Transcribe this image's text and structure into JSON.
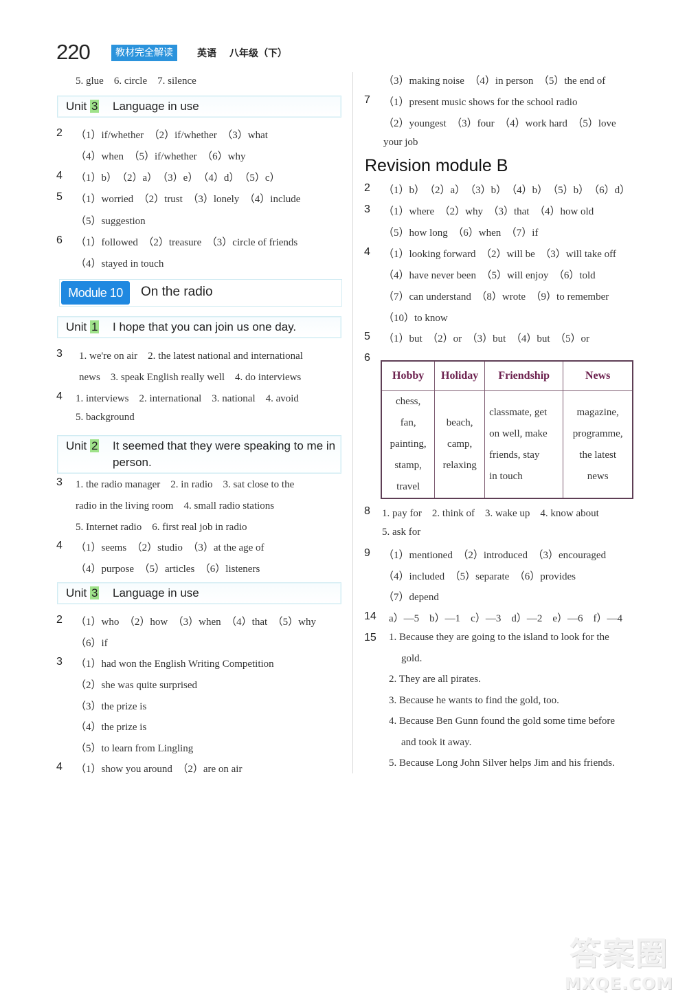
{
  "header": {
    "page_number": "220",
    "book_badge": "教材完全解读",
    "subject": "英语",
    "grade": "八年级（下）"
  },
  "left": {
    "line0": "5. glue　6. circle　7. silence",
    "unit3a": {
      "word": "Unit",
      "num": "3",
      "title": "Language in use"
    },
    "q2": {
      "num": "2",
      "lines": [
        "（1）if/whether　（2）if/whether　（3）what",
        "（4）when　（5）if/whether　（6）why"
      ]
    },
    "q4": {
      "num": "4",
      "lines": [
        "（1）b）　（2）a）　（3）e）　（4）d）　（5）c）"
      ]
    },
    "q5": {
      "num": "5",
      "lines": [
        "（1）worried　（2）trust　（3）lonely　（4）include",
        "（5）suggestion"
      ]
    },
    "q6": {
      "num": "6",
      "lines": [
        "（1）followed　（2）treasure　（3）circle of friends",
        "（4）stayed in touch"
      ]
    },
    "module10": {
      "tag": "Module 10",
      "title": "On the radio"
    },
    "unit1": {
      "word": "Unit",
      "num": "1",
      "title": "I hope that you can join us one day."
    },
    "u1q3": {
      "num": "3",
      "lines": [
        "1. we're on air　2. the latest national and international",
        "news　3. speak English really well　4. do interviews"
      ]
    },
    "u1q4": {
      "num": "4",
      "lines": [
        "1. interviews　2. international　3. national　4. avoid",
        "5. background"
      ]
    },
    "unit2": {
      "word": "Unit",
      "num": "2",
      "title_line1": "It seemed that they were speaking to me in",
      "title_line2": "person."
    },
    "u2q3": {
      "num": "3",
      "lines": [
        "1. the radio manager　2. in radio　3. sat close to the",
        "radio in the living room　4. small radio stations",
        "5. Internet radio　6. first real job in radio"
      ]
    },
    "u2q4": {
      "num": "4",
      "lines": [
        "（1）seems　（2）studio　（3）at the age of",
        "（4）purpose　（5）articles　（6）listeners"
      ]
    },
    "unit3b": {
      "word": "Unit",
      "num": "3",
      "title": "Language in use"
    },
    "u3q2": {
      "num": "2",
      "lines": [
        "（1）who　（2）how　（3）when　（4）that　（5）why",
        "（6）if"
      ]
    },
    "u3q3": {
      "num": "3",
      "lines": [
        "（1）had won the English Writing Competition",
        "（2）she was quite surprised",
        "（3）the prize is",
        "（4）the prize is",
        "（5）to learn from Lingling"
      ]
    },
    "u3q4": {
      "num": "4",
      "lines": [
        "（1）show you around　（2）are on air"
      ]
    }
  },
  "right": {
    "cont": {
      "lines": [
        "（3）making noise　（4）in person　（5）the end of"
      ]
    },
    "q7": {
      "num": "7",
      "lines": [
        "（1）present music shows for the school radio",
        "（2）youngest　（3）four　（4）work hard　（5）love",
        "your job"
      ]
    },
    "revision_title": "Revision module B",
    "rq2": {
      "num": "2",
      "lines": [
        "（1）b）　（2）a）　（3）b）　（4）b）　（5）b）　（6）d）"
      ]
    },
    "rq3": {
      "num": "3",
      "lines": [
        "（1）where　（2）why　（3）that　（4）how old",
        "（5）how long　（6）when　（7）if"
      ]
    },
    "rq4": {
      "num": "4",
      "lines": [
        "（1）looking forward　（2）will be　（3）will take off",
        "（4）have never been　（5）will enjoy　（6）told",
        "（7）can understand　（8）wrote　（9）to remember",
        "（10）to know"
      ]
    },
    "rq5": {
      "num": "5",
      "lines": [
        "（1）but　（2）or　（3）but　（4）but　（5）or"
      ]
    },
    "rq6": {
      "num": "6",
      "headers": [
        "Hobby",
        "Holiday",
        "Friendship",
        "News"
      ],
      "cells": [
        "chess,<br>fan,<br>painting,<br>stamp,<br>travel",
        "beach,<br>camp,<br>relaxing",
        "classmate, get<br>on well, make<br>friends, stay<br>in touch",
        "magazine,<br>programme,<br>the latest<br>news"
      ]
    },
    "rq8": {
      "num": "8",
      "lines": [
        "1. pay for　2. think of　3. wake up　4. know about",
        "5. ask for"
      ]
    },
    "rq9": {
      "num": "9",
      "lines": [
        "（1）mentioned　（2）introduced　（3）encouraged",
        "（4）included　（5）separate　（6）provides",
        "（7）depend"
      ]
    },
    "rq14": {
      "num": "14",
      "lines": [
        "a）—5　b）—1　c）—3　d）—2　e）—6　f）—4"
      ]
    },
    "rq15": {
      "num": "15",
      "lines": [
        "1. Because they are going to the island to look for the",
        "gold.",
        "2. They are all pirates.",
        "3. Because he wants to find the gold, too.",
        "4. Because Ben Gunn found the gold some time before",
        "and took it away.",
        "5. Because Long John Silver helps Jim and his friends."
      ]
    }
  },
  "watermark": {
    "line1": "答案圈",
    "line2": "MXQE.COM"
  },
  "colors": {
    "badge_blue": "#2b93dc",
    "module_blue": "#1f88e0",
    "unit_num_green": "#9fe28a",
    "table_header": "#6b1f4d"
  }
}
